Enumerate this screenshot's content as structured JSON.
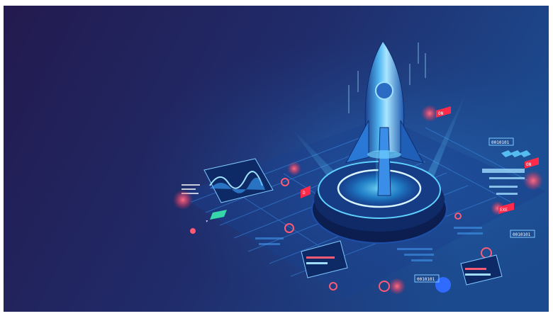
{
  "scene": {
    "tags": {
      "on_top": "ON",
      "on_right": "ON",
      "exe": "EXE",
      "code_a": "0010101",
      "code_b": "0010101",
      "code_c": "0010101",
      "bulb": "D",
      "pin": "▾"
    },
    "colors": {
      "background_left": "#231a4e",
      "background_right": "#1c4a8e",
      "glow": "#29b8ff",
      "accent_red": "#ff3a5a"
    }
  }
}
